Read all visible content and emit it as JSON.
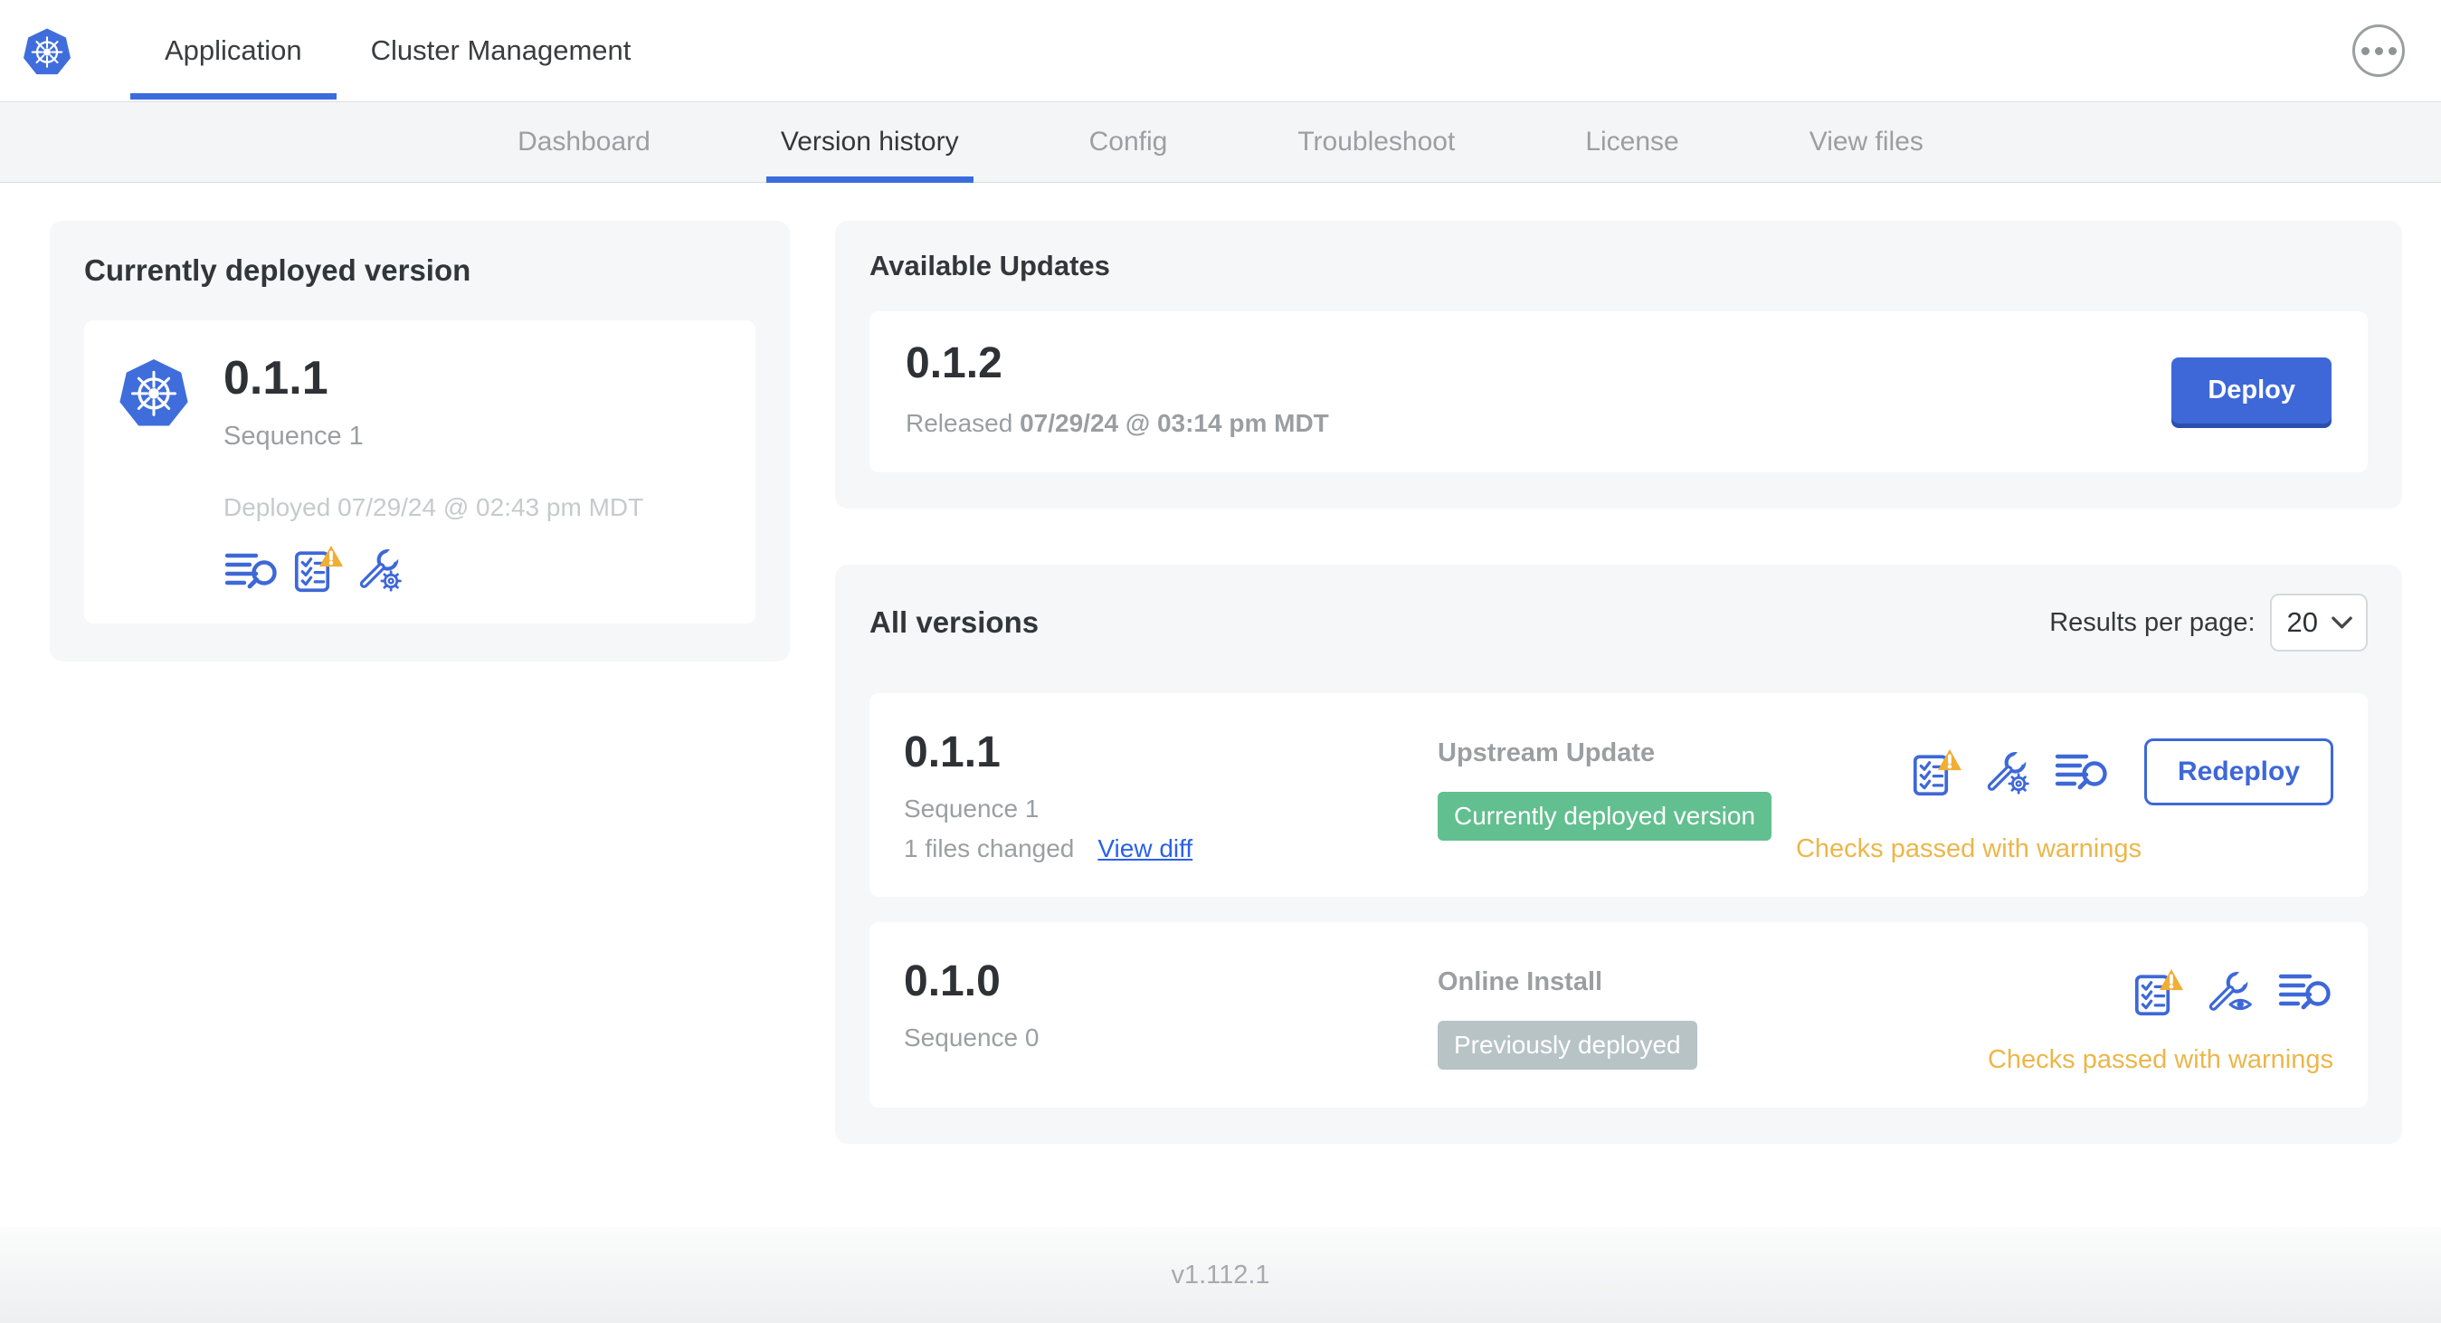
{
  "header": {
    "tabs": [
      {
        "label": "Application"
      },
      {
        "label": "Cluster Management"
      }
    ]
  },
  "subnav": {
    "tabs": [
      {
        "label": "Dashboard"
      },
      {
        "label": "Version history"
      },
      {
        "label": "Config"
      },
      {
        "label": "Troubleshoot"
      },
      {
        "label": "License"
      },
      {
        "label": "View files"
      }
    ]
  },
  "current_version": {
    "title": "Currently deployed version",
    "version": "0.1.1",
    "sequence": "Sequence 1",
    "deployed": "Deployed 07/29/24 @ 02:43 pm MDT",
    "icons": [
      "diff-lines-magnifier-icon",
      "preflight-checks-warning-icon",
      "config-wrench-gear-icon"
    ]
  },
  "available_updates": {
    "title": "Available Updates",
    "version": "0.1.2",
    "released_prefix": "Released",
    "released_date": "07/29/24 @ 03:14 pm MDT",
    "deploy_button": "Deploy"
  },
  "all_versions": {
    "title": "All versions",
    "results_per_page_label": "Results per page:",
    "results_per_page_value": "20",
    "rows": [
      {
        "version": "0.1.1",
        "sequence": "Sequence 1",
        "files_changed": "1 files changed",
        "view_diff": "View diff",
        "source": "Upstream Update",
        "badge_label": "Currently deployed version",
        "badge_color": "#62bf8f",
        "status": "Checks passed with warnings",
        "action_button": "Redeploy",
        "icons": [
          "preflight-checks-warning-icon",
          "config-wrench-gear-icon",
          "diff-lines-magnifier-icon"
        ]
      },
      {
        "version": "0.1.0",
        "sequence": "Sequence 0",
        "source": "Online Install",
        "badge_label": "Previously deployed",
        "badge_color": "#b8c3c6",
        "status": "Checks passed with warnings",
        "icons": [
          "preflight-checks-warning-icon",
          "config-wrench-eye-icon",
          "diff-lines-magnifier-icon"
        ]
      }
    ]
  },
  "footer": {
    "app_version": "v1.112.1"
  },
  "colors": {
    "accent_blue": "#3e68d8",
    "nav_underline_blue": "#3b6cde",
    "warning_orange": "#ecb64a",
    "badge_green": "#62bf8f",
    "badge_gray": "#b8c3c6",
    "panel_gray": "#f5f7f8"
  }
}
